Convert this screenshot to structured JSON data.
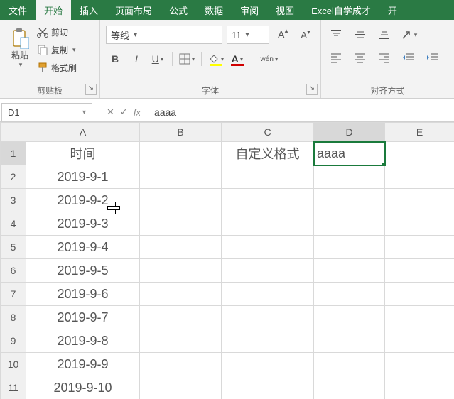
{
  "tabs": {
    "items": [
      "文件",
      "开始",
      "插入",
      "页面布局",
      "公式",
      "数据",
      "审阅",
      "视图",
      "Excel自学成才",
      "开"
    ],
    "active_index": 1
  },
  "ribbon": {
    "clipboard": {
      "paste_label": "粘贴",
      "cut_label": "剪切",
      "copy_label": "复制",
      "painter_label": "格式刷",
      "group_label": "剪贴板"
    },
    "font": {
      "font_name": "等线",
      "font_size": "11",
      "bold": "B",
      "italic": "I",
      "underline": "U",
      "ruby": "wén",
      "group_label": "字体"
    },
    "alignment": {
      "group_label": "对齐方式"
    }
  },
  "formula_bar": {
    "name_box": "D1",
    "cancel": "✕",
    "confirm": "✓",
    "fx": "fx",
    "formula": "aaaa"
  },
  "sheet": {
    "col_headers": [
      "A",
      "B",
      "C",
      "D",
      "E"
    ],
    "active_col_index": 3,
    "active_row_index": 0,
    "rows": [
      {
        "num": "1",
        "A": "时间",
        "B": "",
        "C": "自定义格式",
        "D": "aaaa",
        "E": ""
      },
      {
        "num": "2",
        "A": "2019-9-1",
        "B": "",
        "C": "",
        "D": "",
        "E": ""
      },
      {
        "num": "3",
        "A": "2019-9-2",
        "B": "",
        "C": "",
        "D": "",
        "E": ""
      },
      {
        "num": "4",
        "A": "2019-9-3",
        "B": "",
        "C": "",
        "D": "",
        "E": ""
      },
      {
        "num": "5",
        "A": "2019-9-4",
        "B": "",
        "C": "",
        "D": "",
        "E": ""
      },
      {
        "num": "6",
        "A": "2019-9-5",
        "B": "",
        "C": "",
        "D": "",
        "E": ""
      },
      {
        "num": "7",
        "A": "2019-9-6",
        "B": "",
        "C": "",
        "D": "",
        "E": ""
      },
      {
        "num": "8",
        "A": "2019-9-7",
        "B": "",
        "C": "",
        "D": "",
        "E": ""
      },
      {
        "num": "9",
        "A": "2019-9-8",
        "B": "",
        "C": "",
        "D": "",
        "E": ""
      },
      {
        "num": "10",
        "A": "2019-9-9",
        "B": "",
        "C": "",
        "D": "",
        "E": ""
      },
      {
        "num": "11",
        "A": "2019-9-10",
        "B": "",
        "C": "",
        "D": "",
        "E": ""
      }
    ]
  }
}
